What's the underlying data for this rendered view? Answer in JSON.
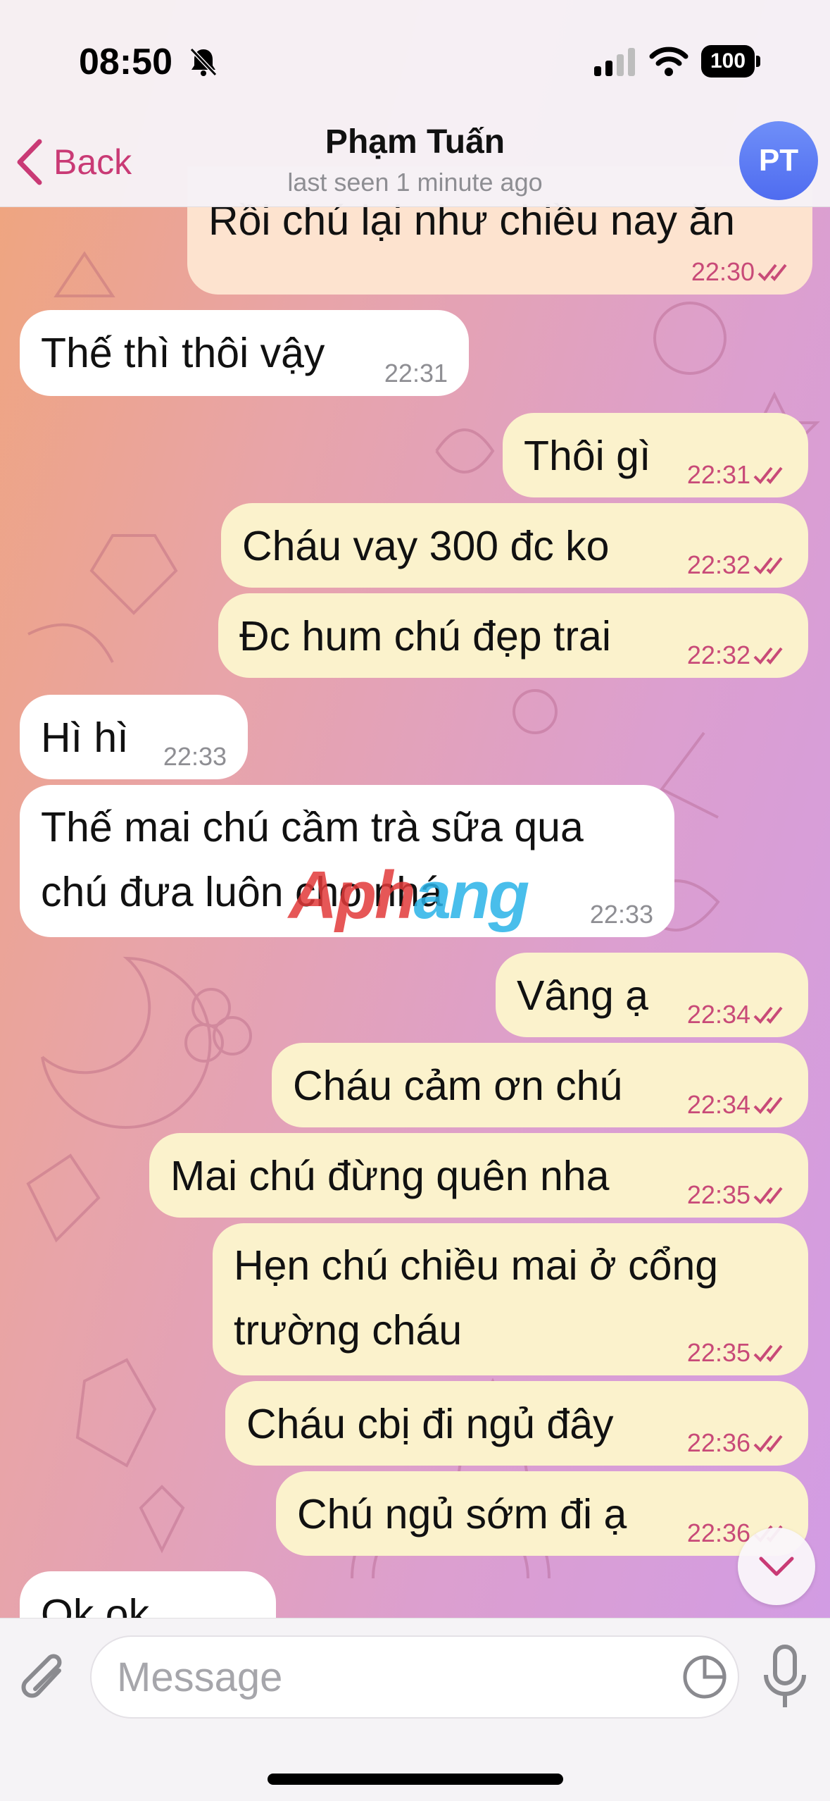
{
  "status": {
    "time": "08:50",
    "battery": "100"
  },
  "header": {
    "back_label": "Back",
    "title": "Phạm Tuấn",
    "subtitle": "last seen 1 minute ago",
    "avatar_initials": "PT"
  },
  "messages": [
    {
      "dir": "out",
      "text": "Rồi chú lại như chiều nay ăn",
      "time": "22:30"
    },
    {
      "dir": "in",
      "text": "Thế thì thôi vậy",
      "time": "22:31"
    },
    {
      "dir": "out",
      "text": "Thôi gì",
      "time": "22:31"
    },
    {
      "dir": "out",
      "text": "Cháu vay 300 đc ko",
      "time": "22:32"
    },
    {
      "dir": "out",
      "text": "Đc hum chú đẹp trai",
      "time": "22:32"
    },
    {
      "dir": "in",
      "text": "Hì hì",
      "time": "22:33"
    },
    {
      "dir": "in",
      "text": "Thế mai chú cầm trà sữa qua chú đưa luôn cho nhá",
      "time": "22:33"
    },
    {
      "dir": "out",
      "text": "Vâng ạ",
      "time": "22:34"
    },
    {
      "dir": "out",
      "text": "Cháu cảm ơn chú",
      "time": "22:34"
    },
    {
      "dir": "out",
      "text": "Mai chú đừng quên nha",
      "time": "22:35"
    },
    {
      "dir": "out",
      "text": "Hẹn chú chiều mai ở cổng trường cháu",
      "time": "22:35"
    },
    {
      "dir": "out",
      "text": "Cháu cbị đi ngủ đây",
      "time": "22:36"
    },
    {
      "dir": "out",
      "text": "Chú ngủ sớm đi ạ",
      "time": "22:36"
    },
    {
      "dir": "in",
      "text": "Ok ok",
      "time": ""
    }
  ],
  "watermark": {
    "part1": "Aph",
    "part2": "ang"
  },
  "composer": {
    "placeholder": "Message"
  },
  "colors": {
    "accent": "#c93a75",
    "incoming_bubble": "#ffffff",
    "outgoing_bubble": "#fbf2cc",
    "avatar": "#5b78f2"
  }
}
